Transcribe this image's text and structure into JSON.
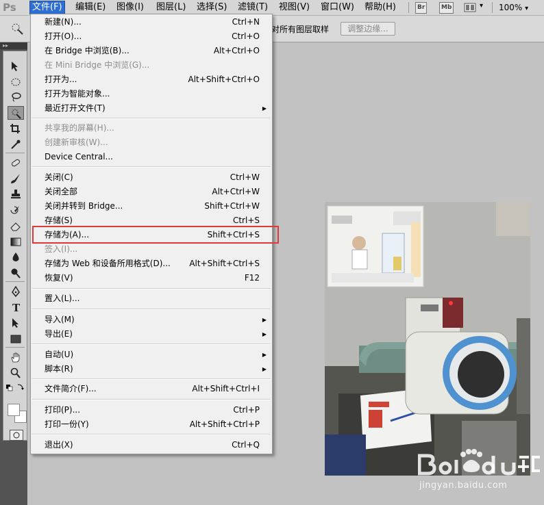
{
  "app": {
    "logo": "Ps"
  },
  "menubar": {
    "items": [
      {
        "label": "文件(F)",
        "active": true
      },
      {
        "label": "编辑(E)"
      },
      {
        "label": "图像(I)"
      },
      {
        "label": "图层(L)"
      },
      {
        "label": "选择(S)"
      },
      {
        "label": "滤镜(T)"
      },
      {
        "label": "视图(V)"
      },
      {
        "label": "窗口(W)"
      },
      {
        "label": "帮助(H)"
      }
    ],
    "br": "Br",
    "mb": "Mb",
    "zoom": "100%",
    "zoom_arrow": "▾",
    "arrange_arrow": "▾"
  },
  "options": {
    "sample_text": "对所有图层取样",
    "refine_edge": "调整边缘..."
  },
  "toolbar": {
    "collapse": "▸▸"
  },
  "file_menu": {
    "items": [
      {
        "label": "新建(N)...",
        "shortcut": "Ctrl+N"
      },
      {
        "label": "打开(O)...",
        "shortcut": "Ctrl+O"
      },
      {
        "label": "在 Bridge 中浏览(B)...",
        "shortcut": "Alt+Ctrl+O"
      },
      {
        "label": "在 Mini Bridge 中浏览(G)...",
        "shortcut": "",
        "disabled": true
      },
      {
        "label": "打开为...",
        "shortcut": "Alt+Shift+Ctrl+O"
      },
      {
        "label": "打开为智能对象...",
        "shortcut": ""
      },
      {
        "label": "最近打开文件(T)",
        "shortcut": "",
        "submenu": true
      },
      {
        "label": "共享我的屏幕(H)...",
        "shortcut": "",
        "disabled": true
      },
      {
        "label": "创建新审核(W)...",
        "shortcut": "",
        "disabled": true
      },
      {
        "label": "Device Central...",
        "shortcut": ""
      },
      {
        "label": "关闭(C)",
        "shortcut": "Ctrl+W"
      },
      {
        "label": "关闭全部",
        "shortcut": "Alt+Ctrl+W"
      },
      {
        "label": "关闭并转到 Bridge...",
        "shortcut": "Shift+Ctrl+W"
      },
      {
        "label": "存储(S)",
        "shortcut": "Ctrl+S"
      },
      {
        "label": "存储为(A)...",
        "shortcut": "Shift+Ctrl+S",
        "highlighted": true
      },
      {
        "label": "签入(I)...",
        "shortcut": "",
        "disabled": true
      },
      {
        "label": "存储为 Web 和设备所用格式(D)...",
        "shortcut": "Alt+Shift+Ctrl+S"
      },
      {
        "label": "恢复(V)",
        "shortcut": "F12"
      },
      {
        "label": "置入(L)...",
        "shortcut": ""
      },
      {
        "label": "导入(M)",
        "shortcut": "",
        "submenu": true
      },
      {
        "label": "导出(E)",
        "shortcut": "",
        "submenu": true
      },
      {
        "label": "自动(U)",
        "shortcut": "",
        "submenu": true
      },
      {
        "label": "脚本(R)",
        "shortcut": "",
        "submenu": true
      },
      {
        "label": "文件简介(F)...",
        "shortcut": "Alt+Shift+Ctrl+I"
      },
      {
        "label": "打印(P)...",
        "shortcut": "Ctrl+P"
      },
      {
        "label": "打印一份(Y)",
        "shortcut": "Alt+Shift+Ctrl+P"
      },
      {
        "label": "退出(X)",
        "shortcut": "Ctrl+Q"
      }
    ],
    "submenu_glyph": "▶"
  },
  "watermark": {
    "url": "jingyan.baidu.com"
  },
  "colors": {
    "highlight_box": "#e0373a",
    "menu_active": "#2f6fd4"
  }
}
